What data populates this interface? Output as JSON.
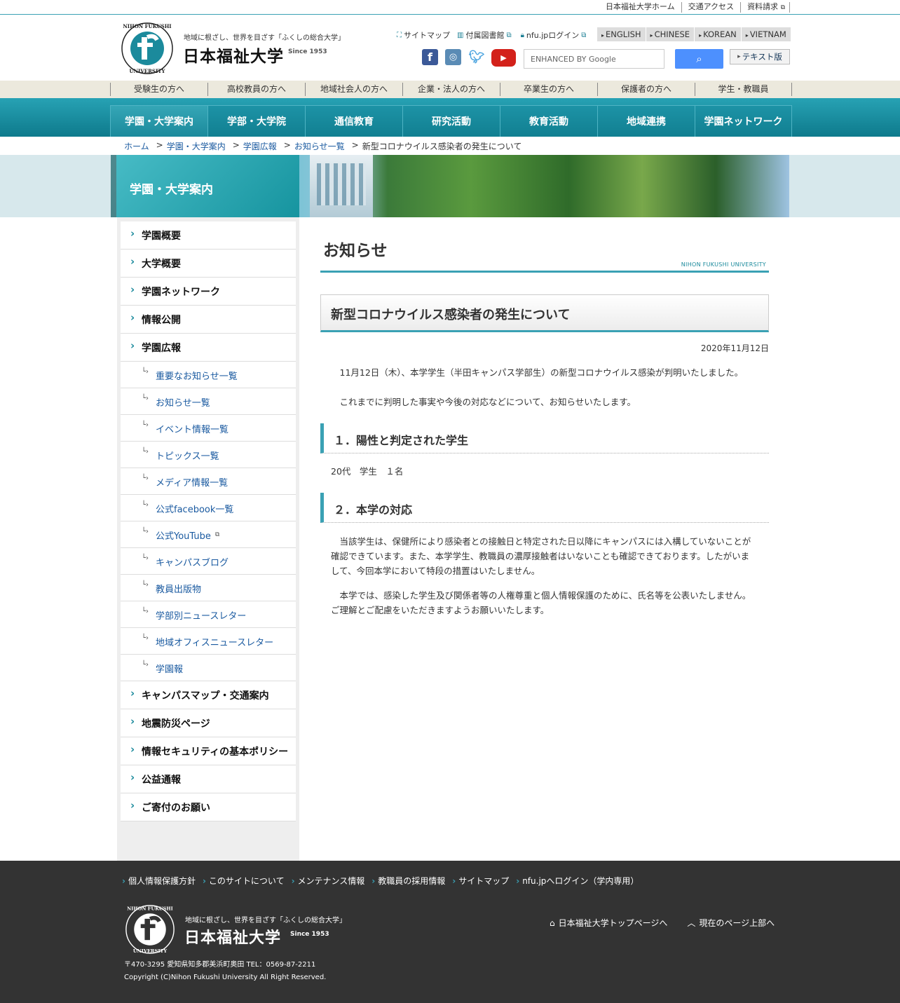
{
  "util_links": [
    "日本福祉大学ホーム",
    "交通アクセス",
    "資料請求"
  ],
  "header": {
    "tagline": "地域に根ざし、世界を目ざす「ふくしの総合大学」",
    "name": "日本福祉大学",
    "since": "Since 1953",
    "links": [
      {
        "label": "サイトマップ",
        "icon": "sitemap-icon"
      },
      {
        "label": "付属図書館",
        "icon": "book-icon"
      },
      {
        "label": "nfu.jpログイン",
        "icon": "lock-icon"
      }
    ],
    "languages": [
      "ENGLISH",
      "CHINESE",
      "KOREAN",
      "VIETNAM"
    ],
    "search_placeholder": "ENHANCED BY Google",
    "text_version": "テキスト版"
  },
  "audience_nav": [
    "受験生の方へ",
    "高校教員の方へ",
    "地域社会人の方へ",
    "企業・法人の方へ",
    "卒業生の方へ",
    "保護者の方へ",
    "学生・教職員"
  ],
  "main_nav": [
    "学園・大学案内",
    "学部・大学院",
    "通信教育",
    "研究活動",
    "教育活動",
    "地域連携",
    "学園ネットワーク"
  ],
  "breadcrumb": [
    "ホーム",
    "学園・大学案内",
    "学園広報",
    "お知らせ一覧",
    "新型コロナウイルス感染者の発生について"
  ],
  "banner_title": "学園・大学案内",
  "sidebar": {
    "top": [
      "学園概要",
      "大学概要",
      "学園ネットワーク",
      "情報公開",
      "学園広報"
    ],
    "sub": [
      "重要なお知らせ一覧",
      "お知らせ一覧",
      "イベント情報一覧",
      "トピックス一覧",
      "メディア情報一覧",
      "公式facebook一覧",
      "公式YouTube",
      "キャンパスブログ",
      "教員出版物",
      "学部別ニュースレター",
      "地域オフィスニュースレター",
      "学園報"
    ],
    "bottom": [
      "キャンパスマップ・交通案内",
      "地震防災ページ",
      "情報セキュリティの基本ポリシー",
      "公益通報",
      "ご寄付のお願い"
    ]
  },
  "content": {
    "heading": "お知らせ",
    "heading_sub": "NIHON FUKUSHI UNIVERSITY",
    "title": "新型コロナウイルス感染者の発生について",
    "date": "2020年11月12日",
    "intro1": "　11月12日（木）、本学学生（半田キャンパス学部生）の新型コロナウイルス感染が判明いたしました。",
    "intro2": "　これまでに判明した事実や今後の対応などについて、お知らせいたします。",
    "sec1_title": "１．陽性と判定された学生",
    "sec1_body": "20代　学生　１名",
    "sec2_title": "２．本学の対応",
    "sec2_p1": "　当該学生は、保健所により感染者との接触日と特定された日以降にキャンパスには入構していないことが確認できています。また、本学学生、教職員の濃厚接触者はいないことも確認できております。したがいまして、今回本学において特段の措置はいたしません。",
    "sec2_p2": "　本学では、感染した学生及び関係者等の人権尊重と個人情報保護のために、氏名等を公表いたしません。ご理解とご配慮をいただきますようお願いいたします。"
  },
  "footer": {
    "links": [
      "個人情報保護方針",
      "このサイトについて",
      "メンテナンス情報",
      "教職員の採用情報",
      "サイトマップ",
      "nfu.jpへログイン（学内専用）"
    ],
    "tagline": "地域に根ざし、世界を目ざす「ふくしの総合大学」",
    "name": "日本福祉大学",
    "since": "Since 1953",
    "top_link": "日本福祉大学トップページへ",
    "page_top": "現在のページ上部へ",
    "address": "〒470-3295 愛知県知多郡美浜町奥田 TEL：0569-87-2211",
    "copyright": "Copyright (C)Nihon Fukushi University All Right Reserved."
  },
  "colors": {
    "accent": "#3aa1b4",
    "nav": "#1b8a9c",
    "footer": "#333333"
  }
}
